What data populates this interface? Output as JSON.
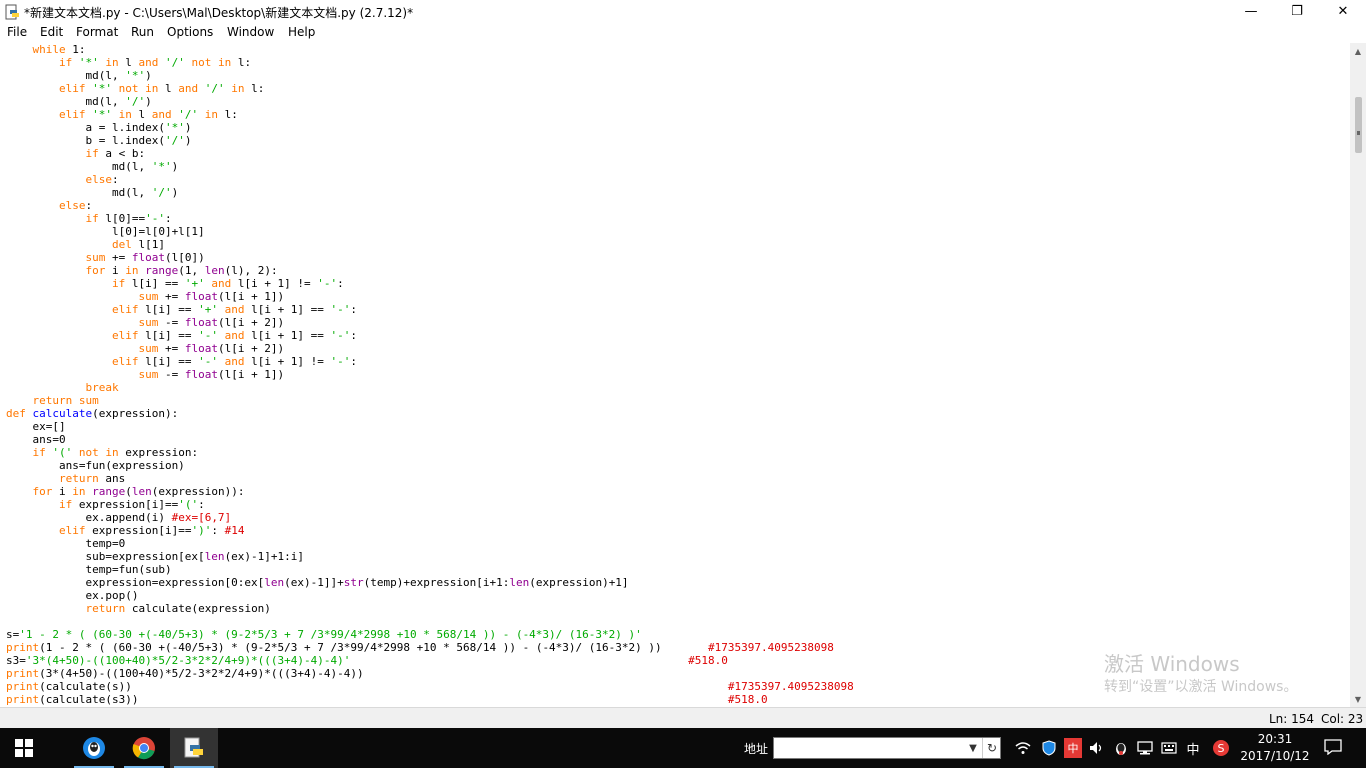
{
  "window": {
    "title": "*新建文本文档.py - C:\\Users\\Mal\\Desktop\\新建文本文档.py (2.7.12)*",
    "minimize_glyph": "—",
    "maximize_glyph": "❐",
    "close_glyph": "✕"
  },
  "menu": [
    "File",
    "Edit",
    "Format",
    "Run",
    "Options",
    "Window",
    "Help"
  ],
  "code_lines": [
    [
      [
        "",
        "    "
      ],
      [
        "kw",
        "while"
      ],
      [
        "",
        " 1:"
      ]
    ],
    [
      [
        "",
        "        "
      ],
      [
        "kw",
        "if"
      ],
      [
        "",
        " "
      ],
      [
        "st",
        "'*'"
      ],
      [
        "",
        " "
      ],
      [
        "kw",
        "in"
      ],
      [
        "",
        " l "
      ],
      [
        "kw",
        "and"
      ],
      [
        "",
        " "
      ],
      [
        "st",
        "'/'"
      ],
      [
        "",
        " "
      ],
      [
        "kw",
        "not in"
      ],
      [
        "",
        " l:"
      ]
    ],
    [
      [
        "",
        "            md(l, "
      ],
      [
        "st",
        "'*'"
      ],
      [
        "",
        ")"
      ]
    ],
    [
      [
        "",
        "        "
      ],
      [
        "kw",
        "elif"
      ],
      [
        "",
        " "
      ],
      [
        "st",
        "'*'"
      ],
      [
        "",
        " "
      ],
      [
        "kw",
        "not in"
      ],
      [
        "",
        " l "
      ],
      [
        "kw",
        "and"
      ],
      [
        "",
        " "
      ],
      [
        "st",
        "'/'"
      ],
      [
        "",
        " "
      ],
      [
        "kw",
        "in"
      ],
      [
        "",
        " l:"
      ]
    ],
    [
      [
        "",
        "            md(l, "
      ],
      [
        "st",
        "'/'"
      ],
      [
        "",
        ")"
      ]
    ],
    [
      [
        "",
        "        "
      ],
      [
        "kw",
        "elif"
      ],
      [
        "",
        " "
      ],
      [
        "st",
        "'*'"
      ],
      [
        "",
        " "
      ],
      [
        "kw",
        "in"
      ],
      [
        "",
        " l "
      ],
      [
        "kw",
        "and"
      ],
      [
        "",
        " "
      ],
      [
        "st",
        "'/'"
      ],
      [
        "",
        " "
      ],
      [
        "kw",
        "in"
      ],
      [
        "",
        " l:"
      ]
    ],
    [
      [
        "",
        "            a = l.index("
      ],
      [
        "st",
        "'*'"
      ],
      [
        "",
        ")"
      ]
    ],
    [
      [
        "",
        "            b = l.index("
      ],
      [
        "st",
        "'/'"
      ],
      [
        "",
        ")"
      ]
    ],
    [
      [
        "",
        "            "
      ],
      [
        "kw",
        "if"
      ],
      [
        "",
        " a < b:"
      ]
    ],
    [
      [
        "",
        "                md(l, "
      ],
      [
        "st",
        "'*'"
      ],
      [
        "",
        ")"
      ]
    ],
    [
      [
        "",
        "            "
      ],
      [
        "kw",
        "else"
      ],
      [
        "",
        ":"
      ]
    ],
    [
      [
        "",
        "                md(l, "
      ],
      [
        "st",
        "'/'"
      ],
      [
        "",
        ")"
      ]
    ],
    [
      [
        "",
        "        "
      ],
      [
        "kw",
        "else"
      ],
      [
        "",
        ":"
      ]
    ],
    [
      [
        "",
        "            "
      ],
      [
        "kw",
        "if"
      ],
      [
        "",
        " l[0]=="
      ],
      [
        "st",
        "'-'"
      ],
      [
        "",
        ":"
      ]
    ],
    [
      [
        "",
        "                l[0]=l[0]+l[1]"
      ]
    ],
    [
      [
        "",
        "                "
      ],
      [
        "kw",
        "del"
      ],
      [
        "",
        " l[1]"
      ]
    ],
    [
      [
        "",
        "            "
      ],
      [
        "kw",
        "sum"
      ],
      [
        "",
        " += "
      ],
      [
        "bi",
        "float"
      ],
      [
        "",
        "(l[0])"
      ]
    ],
    [
      [
        "",
        "            "
      ],
      [
        "kw",
        "for"
      ],
      [
        "",
        " i "
      ],
      [
        "kw",
        "in"
      ],
      [
        "",
        " "
      ],
      [
        "bi",
        "range"
      ],
      [
        "",
        "(1, "
      ],
      [
        "bi",
        "len"
      ],
      [
        "",
        "(l), 2):"
      ]
    ],
    [
      [
        "",
        "                "
      ],
      [
        "kw",
        "if"
      ],
      [
        "",
        " l[i] == "
      ],
      [
        "st",
        "'+'"
      ],
      [
        "",
        " "
      ],
      [
        "kw",
        "and"
      ],
      [
        "",
        " l[i + 1] != "
      ],
      [
        "st",
        "'-'"
      ],
      [
        "",
        ":"
      ]
    ],
    [
      [
        "",
        "                    "
      ],
      [
        "kw",
        "sum"
      ],
      [
        "",
        " += "
      ],
      [
        "bi",
        "float"
      ],
      [
        "",
        "(l[i + 1])"
      ]
    ],
    [
      [
        "",
        "                "
      ],
      [
        "kw",
        "elif"
      ],
      [
        "",
        " l[i] == "
      ],
      [
        "st",
        "'+'"
      ],
      [
        "",
        " "
      ],
      [
        "kw",
        "and"
      ],
      [
        "",
        " l[i + 1] == "
      ],
      [
        "st",
        "'-'"
      ],
      [
        "",
        ":"
      ]
    ],
    [
      [
        "",
        "                    "
      ],
      [
        "kw",
        "sum"
      ],
      [
        "",
        " -= "
      ],
      [
        "bi",
        "float"
      ],
      [
        "",
        "(l[i + 2])"
      ]
    ],
    [
      [
        "",
        "                "
      ],
      [
        "kw",
        "elif"
      ],
      [
        "",
        " l[i] == "
      ],
      [
        "st",
        "'-'"
      ],
      [
        "",
        " "
      ],
      [
        "kw",
        "and"
      ],
      [
        "",
        " l[i + 1] == "
      ],
      [
        "st",
        "'-'"
      ],
      [
        "",
        ":"
      ]
    ],
    [
      [
        "",
        "                    "
      ],
      [
        "kw",
        "sum"
      ],
      [
        "",
        " += "
      ],
      [
        "bi",
        "float"
      ],
      [
        "",
        "(l[i + 2])"
      ]
    ],
    [
      [
        "",
        "                "
      ],
      [
        "kw",
        "elif"
      ],
      [
        "",
        " l[i] == "
      ],
      [
        "st",
        "'-'"
      ],
      [
        "",
        " "
      ],
      [
        "kw",
        "and"
      ],
      [
        "",
        " l[i + 1] != "
      ],
      [
        "st",
        "'-'"
      ],
      [
        "",
        ":"
      ]
    ],
    [
      [
        "",
        "                    "
      ],
      [
        "kw",
        "sum"
      ],
      [
        "",
        " -= "
      ],
      [
        "bi",
        "float"
      ],
      [
        "",
        "(l[i + 1])"
      ]
    ],
    [
      [
        "",
        "            "
      ],
      [
        "kw",
        "break"
      ]
    ],
    [
      [
        "",
        "    "
      ],
      [
        "kw",
        "return"
      ],
      [
        "",
        " "
      ],
      [
        "kw",
        "sum"
      ]
    ],
    [
      [
        "kw",
        "def"
      ],
      [
        "",
        " "
      ],
      [
        "df",
        "calculate"
      ],
      [
        "",
        "(expression):"
      ]
    ],
    [
      [
        "",
        "    ex=[]"
      ]
    ],
    [
      [
        "",
        "    ans=0"
      ]
    ],
    [
      [
        "",
        "    "
      ],
      [
        "kw",
        "if"
      ],
      [
        "",
        " "
      ],
      [
        "st",
        "'('"
      ],
      [
        "",
        " "
      ],
      [
        "kw",
        "not in"
      ],
      [
        "",
        " expression:"
      ]
    ],
    [
      [
        "",
        "        ans=fun(expression)"
      ]
    ],
    [
      [
        "",
        "        "
      ],
      [
        "kw",
        "return"
      ],
      [
        "",
        " ans"
      ]
    ],
    [
      [
        "",
        "    "
      ],
      [
        "kw",
        "for"
      ],
      [
        "",
        " i "
      ],
      [
        "kw",
        "in"
      ],
      [
        "",
        " "
      ],
      [
        "bi",
        "range"
      ],
      [
        "",
        "("
      ],
      [
        "bi",
        "len"
      ],
      [
        "",
        "(expression)):"
      ]
    ],
    [
      [
        "",
        "        "
      ],
      [
        "kw",
        "if"
      ],
      [
        "",
        " expression[i]=="
      ],
      [
        "st",
        "'('"
      ],
      [
        "",
        ":"
      ]
    ],
    [
      [
        "",
        "            ex.append(i) "
      ],
      [
        "cm",
        "#ex=[6,7]"
      ]
    ],
    [
      [
        "",
        "        "
      ],
      [
        "kw",
        "elif"
      ],
      [
        "",
        " expression[i]=="
      ],
      [
        "st",
        "')'"
      ],
      [
        "",
        ": "
      ],
      [
        "cm",
        "#14"
      ]
    ],
    [
      [
        "",
        "            temp=0"
      ]
    ],
    [
      [
        "",
        "            sub=expression[ex["
      ],
      [
        "bi",
        "len"
      ],
      [
        "",
        "(ex)-1]+1:i]"
      ]
    ],
    [
      [
        "",
        "            temp=fun(sub)"
      ]
    ],
    [
      [
        "",
        "            expression=expression[0:ex["
      ],
      [
        "bi",
        "len"
      ],
      [
        "",
        "(ex)-1]]+"
      ],
      [
        "bi",
        "str"
      ],
      [
        "",
        "(temp)+expression[i+1:"
      ],
      [
        "bi",
        "len"
      ],
      [
        "",
        "(expression)+1]"
      ]
    ],
    [
      [
        "",
        "            ex.pop()"
      ]
    ],
    [
      [
        "",
        "            "
      ],
      [
        "kw",
        "return"
      ],
      [
        "",
        " calculate(expression)"
      ]
    ],
    [
      [
        "",
        ""
      ]
    ],
    [
      [
        "",
        "s="
      ],
      [
        "st",
        "'1 - 2 * ( (60-30 +(-40/5+3) * (9-2*5/3 + 7 /3*99/4*2998 +10 * 568/14 )) - (-4*3)/ (16-3*2) )'"
      ]
    ],
    [
      [
        "kw",
        "print"
      ],
      [
        "",
        "(1 - 2 * ( (60-30 +(-40/5+3) * (9-2*5/3 + 7 /3*99/4*2998 +10 * 568/14 )) - (-4*3)/ (16-3*2) ))       "
      ],
      [
        "cm",
        "#1735397.4095238098"
      ]
    ],
    [
      [
        "",
        "s3="
      ],
      [
        "st",
        "'3*(4+50)-((100+40)*5/2-3*2*2/4+9)*(((3+4)-4)-4)'"
      ],
      [
        "",
        "                                                   "
      ],
      [
        "cm",
        "#518.0"
      ]
    ],
    [
      [
        "kw",
        "print"
      ],
      [
        "",
        "(3*(4+50)-((100+40)*5/2-3*2*2/4+9)*(((3+4)-4)-4))"
      ]
    ],
    [
      [
        "kw",
        "print"
      ],
      [
        "",
        "(calculate(s))                                                                                          "
      ],
      [
        "cm",
        "#1735397.4095238098"
      ]
    ],
    [
      [
        "kw",
        "print"
      ],
      [
        "",
        "(calculate(s3))                                                                                         "
      ],
      [
        "cm",
        "#518.0"
      ]
    ]
  ],
  "status": {
    "line": "Ln: 154",
    "col": "Col: 23"
  },
  "watermark": {
    "line1": "激活 Windows",
    "line2": "转到“设置”以激活 Windows。"
  },
  "taskbar": {
    "start_icon": "windows-logo-icon",
    "address_label": "地址",
    "address_value": "",
    "ime_label": "中",
    "ime_badge": "中",
    "clock_time": "20:31",
    "clock_date": "2017/10/12"
  },
  "colors": {
    "keyword": "#ff7700",
    "builtin": "#900090",
    "string": "#00aa00",
    "comment": "#dd0000",
    "definition": "#0000ff",
    "taskbar": "#0a0a0a"
  }
}
